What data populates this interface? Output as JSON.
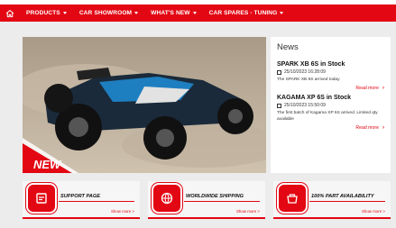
{
  "nav": {
    "items": [
      {
        "label": "PRODUCTS"
      },
      {
        "label": "CAR SHOWROOM"
      },
      {
        "label": "WHAT'S NEW"
      },
      {
        "label": "CAR SPARES - TUNING"
      }
    ]
  },
  "hero": {
    "badge_text": "NEW"
  },
  "news": {
    "title": "News",
    "items": [
      {
        "headline": "SPARK XB 6S in Stock",
        "date": "25/10/2023 16:28:09",
        "text": "The SPARK XB 6S arrived today",
        "read_more": "Read more"
      },
      {
        "headline": "KAGAMA XP 6S in Stock",
        "date": "25/10/2023 15:50:09",
        "text": "The first batch of Kagama XP 6S arrived. Limited qty available",
        "read_more": "Read more"
      }
    ]
  },
  "features": [
    {
      "label": "SUPPORT PAGE",
      "more": "Show more >",
      "icon": "support-icon"
    },
    {
      "label": "WORLDWIDE SHIPPING",
      "more": "Show more >",
      "icon": "shipping-icon"
    },
    {
      "label": "100% PART AVAILABILITY",
      "more": "Show more >",
      "icon": "parts-icon"
    }
  ],
  "colors": {
    "brand": "#e30613",
    "background": "#ececec"
  }
}
